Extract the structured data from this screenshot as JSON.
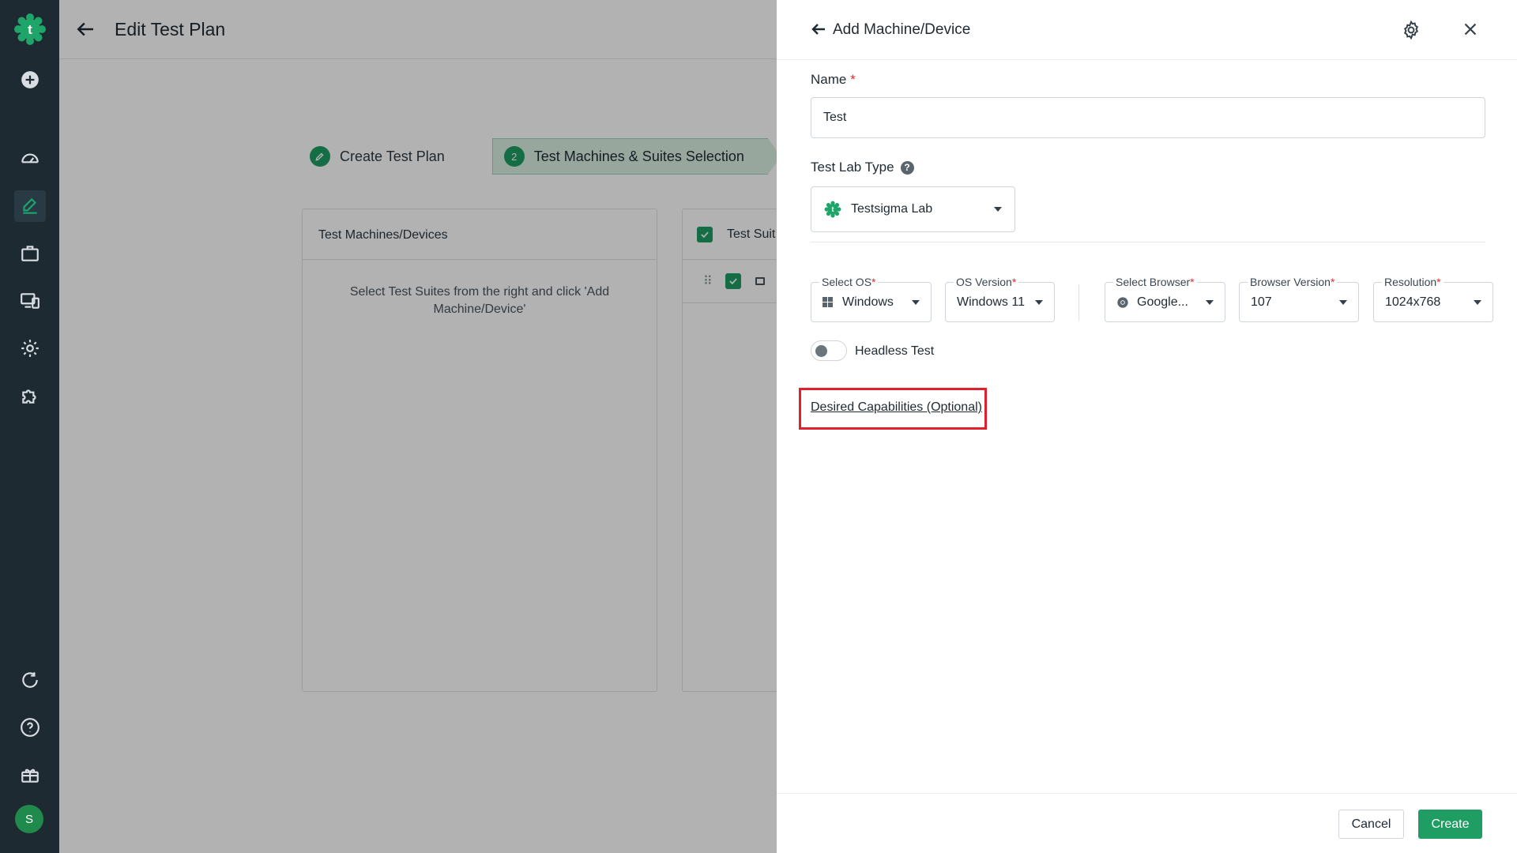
{
  "sidebar": {
    "items": [
      {
        "icon": "plus-circle-icon"
      },
      {
        "icon": "dashboard-icon"
      },
      {
        "icon": "edit-icon",
        "active": true
      },
      {
        "icon": "briefcase-icon"
      },
      {
        "icon": "devices-icon"
      },
      {
        "icon": "gear-icon"
      },
      {
        "icon": "puzzle-icon"
      },
      {
        "icon": "refresh-icon"
      },
      {
        "icon": "help-icon"
      },
      {
        "icon": "gift-icon"
      }
    ],
    "avatar_initial": "S"
  },
  "header": {
    "title": "Edit Test Plan"
  },
  "steps": [
    {
      "label": "Create Test Plan"
    },
    {
      "number": "2",
      "label": "Test Machines & Suites Selection"
    }
  ],
  "machines_panel": {
    "title": "Test Machines/Devices",
    "empty_message": "Select Test Suites from the right and click 'Add Machine/Device'"
  },
  "suites_panel": {
    "title": "Test Suit"
  },
  "drawer": {
    "title": "Add Machine/Device",
    "name_label": "Name",
    "name_value": "Test",
    "lab_type_label": "Test Lab Type",
    "lab_type_value": "Testsigma Lab",
    "fields": {
      "os": {
        "label": "Select OS",
        "value": "Windows"
      },
      "os_version": {
        "label": "OS Version",
        "value": "Windows 11"
      },
      "browser": {
        "label": "Select Browser",
        "value": "Google..."
      },
      "browser_version": {
        "label": "Browser Version",
        "value": "107"
      },
      "resolution": {
        "label": "Resolution",
        "value": "1024x768"
      }
    },
    "headless_label": "Headless Test",
    "headless_enabled": false,
    "desired_capabilities_link": "Desired Capabilities (Optional)",
    "cancel_label": "Cancel",
    "create_label": "Create"
  },
  "colors": {
    "brand_green": "#1f9d63",
    "sidebar_bg": "#1e2a32",
    "highlight_red": "#e0202a"
  }
}
